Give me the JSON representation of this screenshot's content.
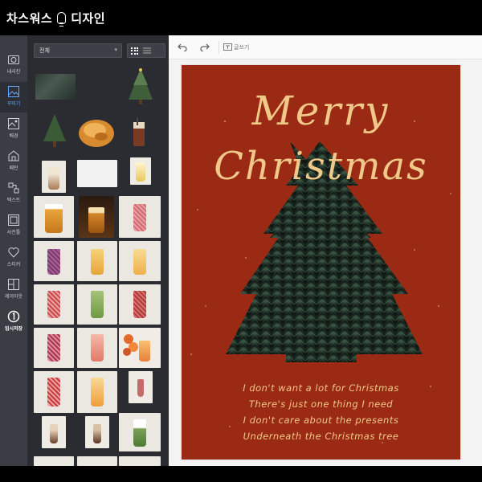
{
  "app": {
    "title": "차스워스",
    "title_suffix": "디자인"
  },
  "sidebar": {
    "items": [
      {
        "label": "내사진",
        "icon": "camera-icon"
      },
      {
        "label": "꾸미기",
        "icon": "sticker-icon",
        "active": true
      },
      {
        "label": "배경",
        "icon": "background-icon"
      },
      {
        "label": "패턴",
        "icon": "pattern-icon"
      },
      {
        "label": "텍스트",
        "icon": "text-icon"
      },
      {
        "label": "사진틀",
        "icon": "frame-icon"
      },
      {
        "label": "스티커",
        "icon": "heart-icon"
      },
      {
        "label": "레이아웃",
        "icon": "layout-icon"
      },
      {
        "label": "임시저장",
        "icon": "save-icon"
      }
    ]
  },
  "asset_panel": {
    "filter_label": "전체",
    "view_modes": [
      "grid-icon",
      "list-icon"
    ]
  },
  "toolbar": {
    "undo_icon": "undo-icon",
    "redo_icon": "redo-icon",
    "text_tool_label": "글쓰기"
  },
  "card": {
    "background": "#9a2a14",
    "accent": "#f0c98a",
    "headline_line1": "Merry",
    "headline_line2": "Christmas",
    "lyrics": [
      "I don't want a lot for Christmas",
      "There's just one thing I need",
      "I don't care about the presents",
      "Underneath the Christmas tree"
    ]
  }
}
